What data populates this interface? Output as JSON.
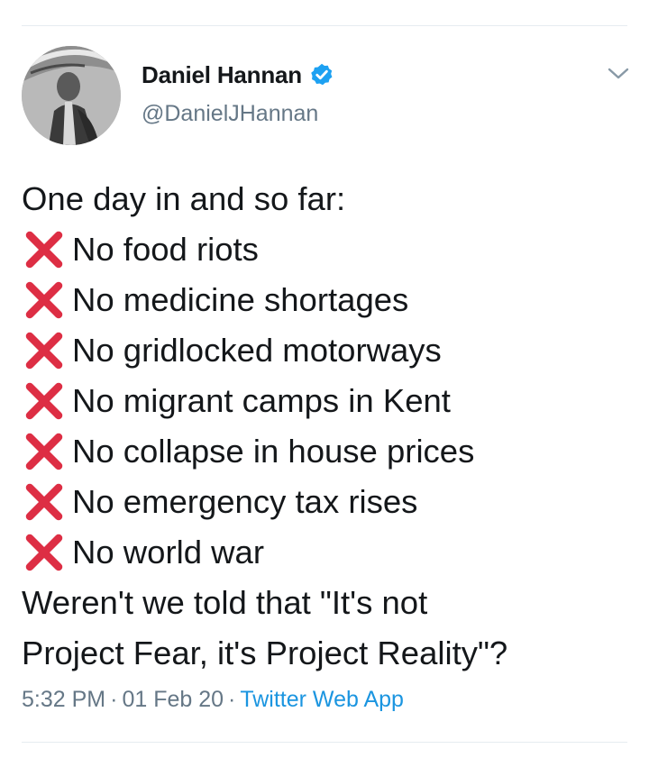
{
  "author": {
    "display_name": "Daniel Hannan",
    "handle": "@DanielJHannan",
    "verified": true,
    "avatar_icon": "profile-photo"
  },
  "tweet": {
    "intro": "One day in and so far:",
    "list_marker_icon": "cross-mark-emoji",
    "items": [
      "No food riots",
      "No medicine shortages",
      "No gridlocked motorways",
      "No migrant camps in Kent",
      "No collapse in house prices",
      "No emergency tax rises",
      "No world war"
    ],
    "closing": [
      "Weren't we told that \"It's not",
      "Project Fear, it's Project Reality\"?"
    ]
  },
  "meta": {
    "time": "5:32 PM",
    "date": "01 Feb 20",
    "separator": "·",
    "source": "Twitter Web App"
  },
  "colors": {
    "text": "#14171a",
    "secondary": "#657786",
    "link": "#1b95e0",
    "verified": "#1da1f2",
    "cross": "#dd2e44"
  }
}
